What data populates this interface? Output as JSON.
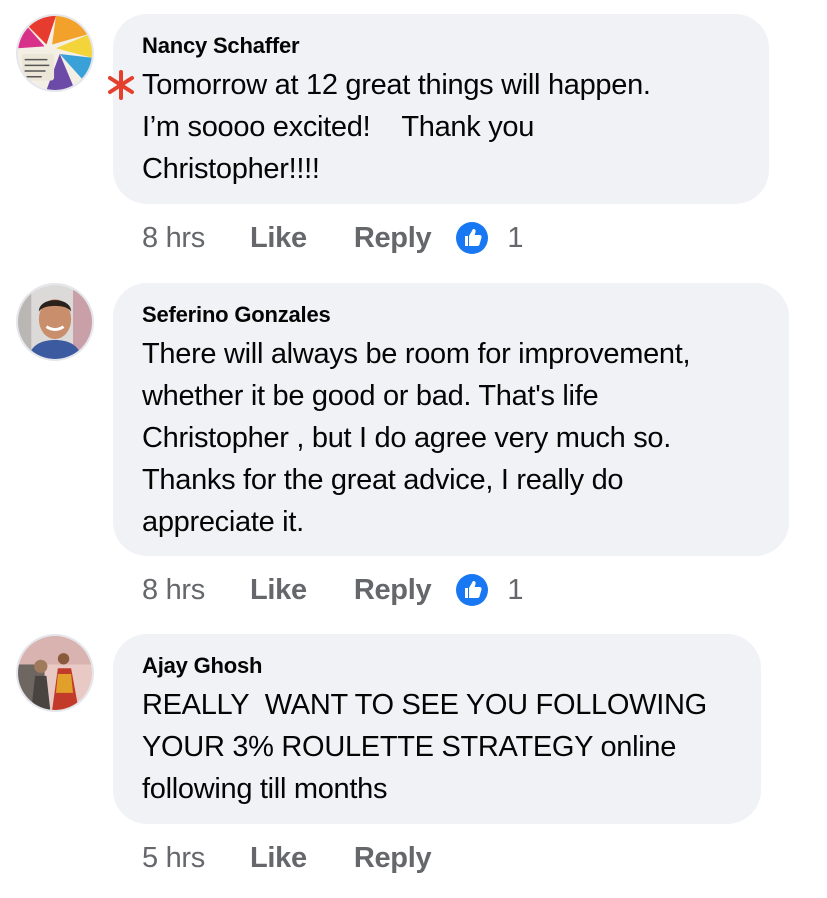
{
  "colors": {
    "bubble_bg": "#f0f2f5",
    "meta_text": "#65676b",
    "like_blue": "#1877f2",
    "asterisk_red": "#e4402c"
  },
  "comments": [
    {
      "author": "Nancy Schaffer",
      "lines": [
        "Tomorrow at 12 great things will happen.",
        "I’m soooo excited!    Thank you",
        "Christopher!!!!"
      ],
      "time": "8 hrs",
      "like_label": "Like",
      "reply_label": "Reply",
      "reaction_icon": "like-reaction-icon",
      "reaction_count": "1",
      "avatar_icon": "rainbow-paint-avatar"
    },
    {
      "author": "Seferino Gonzales",
      "lines": [
        "There will always be room for improvement,",
        "whether it be good or bad. That's life",
        "Christopher , but I do agree very much so.",
        "Thanks for the great advice, I really do",
        "appreciate it."
      ],
      "time": "8 hrs",
      "like_label": "Like",
      "reply_label": "Reply",
      "reaction_icon": "like-reaction-icon",
      "reaction_count": "1",
      "avatar_icon": "portrait-avatar"
    },
    {
      "author": "Ajay Ghosh",
      "lines": [
        "REALLY  WANT TO SEE YOU FOLLOWING",
        "YOUR 3% ROULETTE STRATEGY online",
        "following till months"
      ],
      "time": "5 hrs",
      "like_label": "Like",
      "reply_label": "Reply",
      "avatar_icon": "photo-avatar"
    }
  ]
}
